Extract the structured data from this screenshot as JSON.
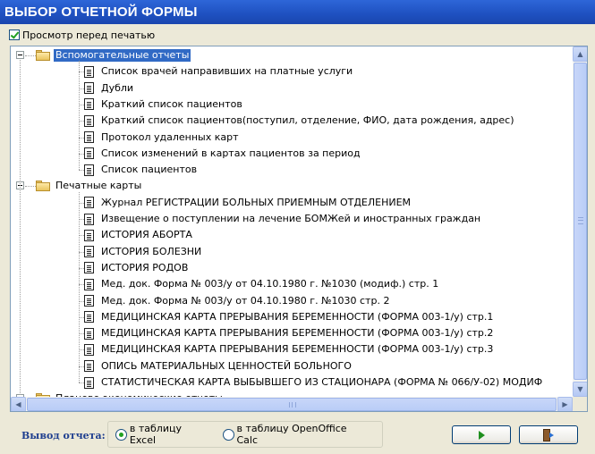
{
  "window": {
    "title": "ВЫБОР ОТЧЕТНОЙ ФОРМЫ"
  },
  "preview": {
    "label": "Просмотр перед печатью",
    "checked": true
  },
  "tree": {
    "groups": [
      {
        "label": "Вспомогательные отчеты",
        "selected": true,
        "items": [
          "Список врачей направивших на платные услуги",
          "Дубли",
          "Краткий список пациентов",
          "Краткий список пациентов(поступил, отделение, ФИО, дата рождения, адрес)",
          "Протокол удаленных карт",
          "Список изменений в картах пациентов за период",
          "Список пациентов"
        ]
      },
      {
        "label": "Печатные карты",
        "selected": false,
        "items": [
          "Журнал РЕГИСТРАЦИИ БОЛЬНЫХ ПРИЕМНЫМ ОТДЕЛЕНИЕМ",
          "Извещение о поступлении на лечение БОМЖей и иностранных граждан",
          "ИСТОРИЯ АБОРТА",
          "ИСТОРИЯ БОЛЕЗНИ",
          "ИСТОРИЯ РОДОВ",
          "Мед. док. Форма № 003/у от 04.10.1980 г. №1030 (модиф.) стр. 1",
          "Мед. док. Форма № 003/у от 04.10.1980 г. №1030 стр. 2",
          "МЕДИЦИНСКАЯ КАРТА ПРЕРЫВАНИЯ БЕРЕМЕННОСТИ (ФОРМА 003-1/у) стр.1",
          "МЕДИЦИНСКАЯ КАРТА ПРЕРЫВАНИЯ БЕРЕМЕННОСТИ (ФОРМА 003-1/у) стр.2",
          "МЕДИЦИНСКАЯ КАРТА ПРЕРЫВАНИЯ БЕРЕМЕННОСТИ (ФОРМА 003-1/у) стр.3",
          "ОПИСЬ МАТЕРИАЛЬНЫХ ЦЕННОСТЕЙ БОЛЬНОГО",
          "СТАТИСТИЧЕСКАЯ КАРТА ВЫБЫВШЕГО ИЗ СТАЦИОНАРА (ФОРМА № 066/У-02) МОДИФ"
        ]
      },
      {
        "label": "Планово-экономические отчеты",
        "selected": false,
        "items": []
      }
    ]
  },
  "output": {
    "label": "Вывод отчета:",
    "options": [
      {
        "label": "в таблицу Excel",
        "checked": true
      },
      {
        "label": "в таблицу OpenOffice Calc",
        "checked": false
      }
    ]
  },
  "icons": {
    "run": "play-icon",
    "exit": "exit-door-icon",
    "folder": "folder-icon",
    "document": "document-icon"
  },
  "colors": {
    "title_bar": "#1E50C0",
    "selection": "#316AC5",
    "output_label": "#1F3F8F",
    "radio_check": "#21A121"
  }
}
